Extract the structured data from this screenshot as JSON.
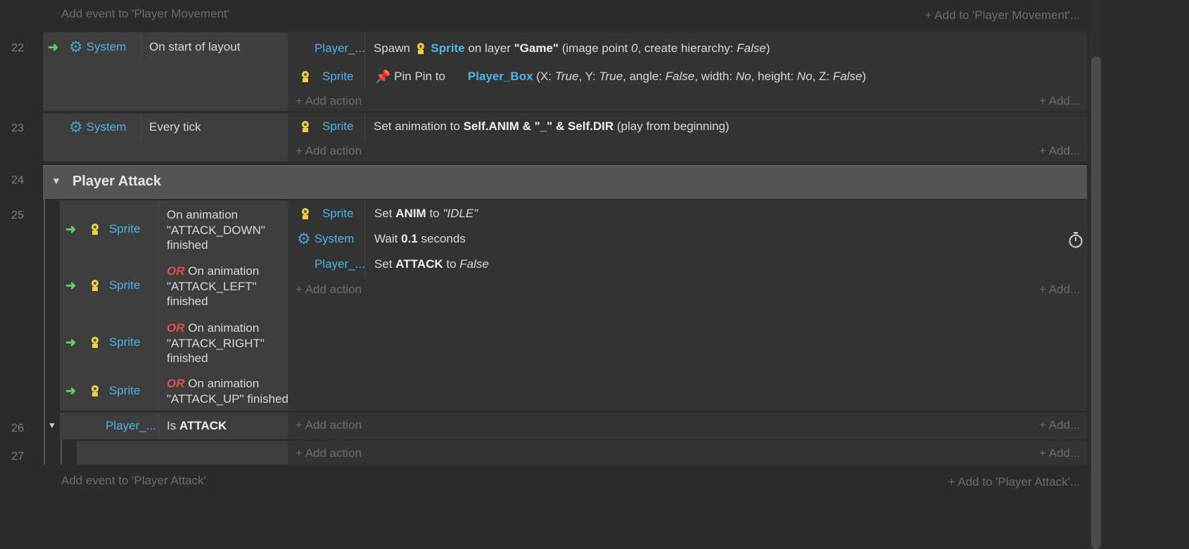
{
  "top_add": {
    "left": "Add event to 'Player Movement'",
    "right": "+ Add to 'Player Movement'..."
  },
  "bottom_add": {
    "left": "Add event to 'Player Attack'",
    "right": "+ Add to 'Player Attack'..."
  },
  "add_action": "+ Add action",
  "add_more": "+ Add...",
  "events": {
    "e22": {
      "num": "22",
      "cond_obj": "System",
      "cond_text": "On start of layout",
      "a1_obj": "Player_...",
      "a1_pre": "Spawn",
      "a1_sprite": "Sprite",
      "a1_mid": "on layer",
      "a1_layer": "\"Game\"",
      "a1_p1": "(image point",
      "a1_p2": "0",
      "a1_p3": ", create hierarchy:",
      "a1_p4": "False",
      "a1_p5": ")",
      "a2_obj": "Sprite",
      "a2_pre": "Pin Pin to",
      "a2_target": "Player_Box",
      "a2_o": "(X:",
      "a2_x": "True",
      "a2_y_lbl": ", Y:",
      "a2_y": "True",
      "a2_ang_lbl": ", angle:",
      "a2_ang": "False",
      "a2_w_lbl": ", width:",
      "a2_w": "No",
      "a2_h_lbl": ", height:",
      "a2_h": "No",
      "a2_z_lbl": ", Z:",
      "a2_z": "False",
      "a2_c": ")"
    },
    "e23": {
      "num": "23",
      "cond_obj": "System",
      "cond_text": "Every tick",
      "a1_obj": "Sprite",
      "a1_pre": "Set animation to",
      "a1_expr": "Self.ANIM & \"_\" & Self.DIR",
      "a1_post": "(play from beginning)"
    },
    "group24": {
      "num": "24",
      "title": "Player Attack"
    },
    "e25": {
      "num": "25",
      "conds": [
        {
          "obj": "Sprite",
          "or": "",
          "l1": "On animation",
          "l2": "\"ATTACK_DOWN\"",
          "l3": "finished"
        },
        {
          "obj": "Sprite",
          "or": "OR",
          "l1": "On animation",
          "l2": "\"ATTACK_LEFT\"",
          "l3": "finished"
        },
        {
          "obj": "Sprite",
          "or": "OR",
          "l1": "On animation",
          "l2": "\"ATTACK_RIGHT\"",
          "l3": "finished"
        },
        {
          "obj": "Sprite",
          "or": "OR",
          "l1": "On animation",
          "l2": "\"ATTACK_UP\" finished",
          "l3": ""
        }
      ],
      "a1_obj": "Sprite",
      "a1_pre": "Set",
      "a1_var": "ANIM",
      "a1_to": "to",
      "a1_val": "\"IDLE\"",
      "a2_obj": "System",
      "a2_pre": "Wait",
      "a2_val": "0.1",
      "a2_post": "seconds",
      "a3_obj": "Player_...",
      "a3_pre": "Set",
      "a3_var": "ATTACK",
      "a3_to": "to",
      "a3_val": "False"
    },
    "e26": {
      "num": "26",
      "cond_obj": "Player_...",
      "cond_pre": "Is",
      "cond_var": "ATTACK"
    },
    "e27": {
      "num": "27"
    }
  }
}
